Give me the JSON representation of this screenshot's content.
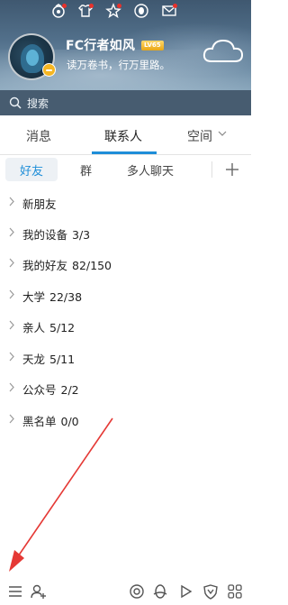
{
  "header": {
    "nickname": "FC行者如风",
    "level_badge": "LV65",
    "signature": "读万卷书，行万里路。",
    "icons": [
      "qq-zone-icon",
      "shirt-icon",
      "star-icon",
      "qq-penguin-icon",
      "mail-icon",
      "weather-cloud-icon"
    ]
  },
  "search": {
    "placeholder": "搜索"
  },
  "tabs": {
    "messages": "消息",
    "contacts": "联系人",
    "space": "空间"
  },
  "subtabs": {
    "friends": "好友",
    "groups": "群",
    "multi_chat": "多人聊天"
  },
  "groups": [
    {
      "name": "新朋友",
      "count": ""
    },
    {
      "name": "我的设备",
      "count": "3/3"
    },
    {
      "name": "我的好友",
      "count": "82/150"
    },
    {
      "name": "大学",
      "count": "22/38"
    },
    {
      "name": "亲人",
      "count": "5/12"
    },
    {
      "name": "天龙",
      "count": "5/11"
    },
    {
      "name": "公众号",
      "count": "2/2"
    },
    {
      "name": "黑名单",
      "count": "0/0"
    }
  ],
  "bottom_icons": [
    "menu-icon",
    "add-friend-icon",
    "mention-icon",
    "penguin-game-icon",
    "play-icon",
    "heart-shield-icon",
    "apps-grid-icon"
  ],
  "colors": {
    "accent": "#1e8ed8",
    "notification_dot": "#e8312b",
    "arrow": "#e53935"
  }
}
